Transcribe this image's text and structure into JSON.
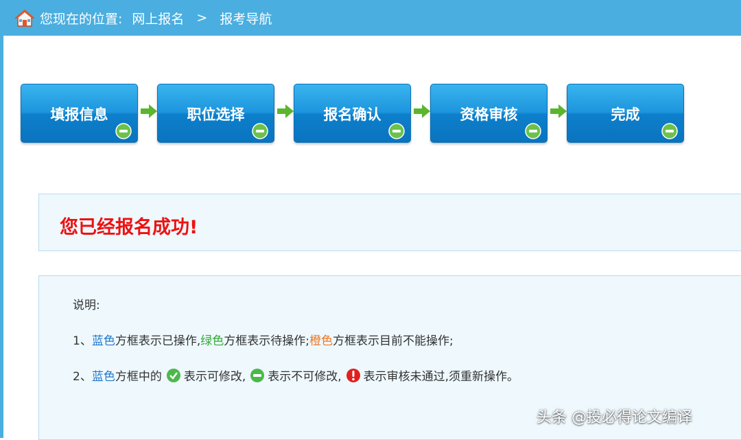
{
  "header": {
    "location_label": "您现在的位置:",
    "crumbs": [
      "网上报名",
      "报考导航"
    ],
    "separator": ">"
  },
  "steps": [
    {
      "label": "填报信息"
    },
    {
      "label": "职位选择"
    },
    {
      "label": "报名确认"
    },
    {
      "label": "资格审核"
    },
    {
      "label": "完成"
    }
  ],
  "success": {
    "message": "您已经报名成功!"
  },
  "notes": {
    "title": "说明:",
    "line1": {
      "num": "1、",
      "blue": "蓝色",
      "t1": "方框表示已操作,",
      "green": "绿色",
      "t2": "方框表示待操作;",
      "orange": "橙色",
      "t3": "方框表示目前不能操作;"
    },
    "line2": {
      "num": "2、",
      "blue": "蓝色",
      "t1": "方框中的",
      "t2": "表示可修改,",
      "t3": "表示不可修改,",
      "t4": "表示审核未通过,须重新操作。"
    }
  },
  "watermark": "头条 @投必得论文编译",
  "colors": {
    "header_bg": "#4aaee0",
    "step_blue": "#1d95dd",
    "success_red": "#ee1111",
    "blue_text": "#2277cc",
    "green_text": "#33aa33",
    "orange_text": "#ee7722"
  },
  "icons": {
    "home": "home-icon",
    "step_status": "minus-circle-icon",
    "arrow": "arrow-right-icon",
    "check": "check-circle-icon",
    "minus": "minus-circle-icon",
    "error": "exclamation-circle-icon"
  }
}
